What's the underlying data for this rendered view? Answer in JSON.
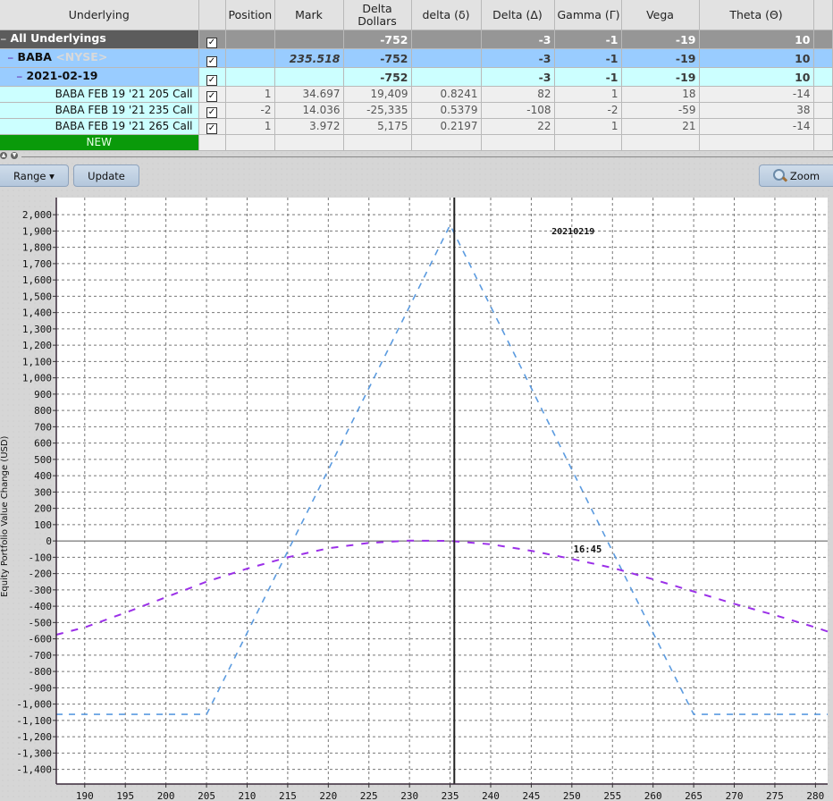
{
  "table": {
    "headers": [
      {
        "key": "underlying",
        "label": "Underlying"
      },
      {
        "key": "check",
        "label": ""
      },
      {
        "key": "position",
        "label": "Position"
      },
      {
        "key": "mark",
        "label": "Mark"
      },
      {
        "key": "delta_dollars",
        "label": "Delta Dollars"
      },
      {
        "key": "delta_lc",
        "label": "delta (δ)"
      },
      {
        "key": "delta_uc",
        "label": "Delta (Δ)"
      },
      {
        "key": "gamma",
        "label": "Gamma (Γ)"
      },
      {
        "key": "vega",
        "label": "Vega"
      },
      {
        "key": "theta",
        "label": "Theta (Θ)"
      }
    ],
    "rows": [
      {
        "type": "all",
        "name": "All Underlyings",
        "checked": true,
        "position": "",
        "mark": "",
        "delta_dollars": "-752",
        "delta_lc": "",
        "delta_uc": "-3",
        "gamma": "-1",
        "vega": "-19",
        "theta": "10"
      },
      {
        "type": "underlying",
        "name": "BABA",
        "exchange": "<NYSE>",
        "checked": true,
        "position": "",
        "mark": "235.518",
        "delta_dollars": "-752",
        "delta_lc": "",
        "delta_uc": "-3",
        "gamma": "-1",
        "vega": "-19",
        "theta": "10"
      },
      {
        "type": "expiry",
        "name": "2021-02-19",
        "checked": true,
        "position": "",
        "mark": "",
        "delta_dollars": "-752",
        "delta_lc": "",
        "delta_uc": "-3",
        "gamma": "-1",
        "vega": "-19",
        "theta": "10"
      },
      {
        "type": "leg",
        "name": "BABA FEB 19 '21 205 Call",
        "checked": true,
        "position": "1",
        "mark": "34.697",
        "delta_dollars": "19,409",
        "delta_lc": "0.8241",
        "delta_uc": "82",
        "gamma": "1",
        "vega": "18",
        "theta": "-14"
      },
      {
        "type": "leg",
        "name": "BABA FEB 19 '21 235 Call",
        "checked": true,
        "position": "-2",
        "mark": "14.036",
        "delta_dollars": "-25,335",
        "delta_lc": "0.5379",
        "delta_uc": "-108",
        "gamma": "-2",
        "vega": "-59",
        "theta": "38"
      },
      {
        "type": "leg",
        "name": "BABA FEB 19 '21 265 Call",
        "checked": true,
        "position": "1",
        "mark": "3.972",
        "delta_dollars": "5,175",
        "delta_lc": "0.2197",
        "delta_uc": "22",
        "gamma": "1",
        "vega": "21",
        "theta": "-14"
      },
      {
        "type": "new",
        "name": "NEW"
      }
    ]
  },
  "toolbar": {
    "range_label": "Range ▾",
    "update_label": "Update",
    "zoom_label": "Zoom"
  },
  "icons": {
    "splitter_up": "▲",
    "splitter_down": "▼",
    "checkbox": "✓",
    "tree_collapse": "−"
  },
  "colors": {
    "expiry_line": "#5b9be0",
    "today_line": "#9b30e8",
    "current_price_line": "#333333"
  },
  "chart_data": {
    "type": "line",
    "title": "",
    "xlabel": "",
    "ylabel": "Equity Portfolio Value Change (USD)",
    "xlim": [
      186.5,
      281.5
    ],
    "ylim": [
      -1490,
      2105
    ],
    "x_ticks": [
      190,
      195,
      200,
      205,
      210,
      215,
      220,
      225,
      230,
      235,
      240,
      245,
      250,
      255,
      260,
      265,
      270,
      275,
      280
    ],
    "y_ticks": [
      2000,
      1900,
      1800,
      1700,
      1600,
      1500,
      1400,
      1300,
      1200,
      1100,
      1000,
      900,
      800,
      700,
      600,
      500,
      400,
      300,
      200,
      100,
      0,
      -100,
      -200,
      -300,
      -400,
      -500,
      -600,
      -700,
      -800,
      -900,
      -1000,
      -1100,
      -1200,
      -1300,
      -1400
    ],
    "grid": true,
    "current_price": 235.518,
    "series": [
      {
        "name": "20210219",
        "label": "20210219",
        "style": "dashed",
        "x": [
          186.5,
          205,
          235,
          265,
          281.5
        ],
        "y": [
          -1063,
          -1063,
          1937,
          -1063,
          -1063
        ]
      },
      {
        "name": "16:45",
        "label": "16:45",
        "style": "dashed",
        "x": [
          186.5,
          190,
          195,
          200,
          205,
          210,
          215,
          220,
          225,
          230,
          235,
          240,
          245,
          250,
          255,
          260,
          265,
          270,
          275,
          280,
          281.5
        ],
        "y": [
          -575,
          -530,
          -440,
          -345,
          -250,
          -170,
          -100,
          -45,
          -12,
          2,
          0,
          -20,
          -60,
          -110,
          -165,
          -235,
          -310,
          -385,
          -455,
          -530,
          -555
        ]
      }
    ]
  }
}
